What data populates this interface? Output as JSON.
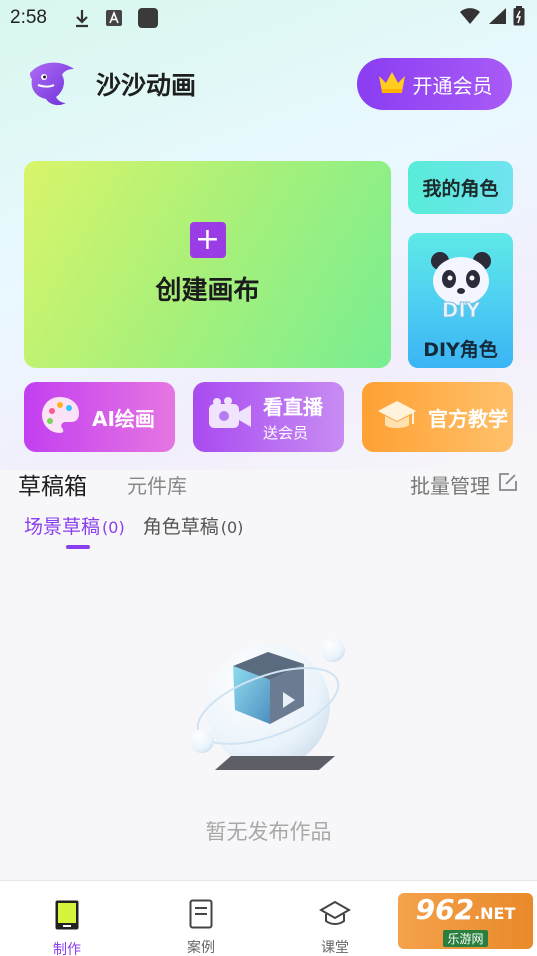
{
  "status_bar": {
    "time": "2:58",
    "icons": [
      "download-icon",
      "text-a-icon",
      "app-square-icon",
      "wifi-icon",
      "signal-icon",
      "battery-icon"
    ]
  },
  "header": {
    "app_title": "沙沙动画",
    "vip_button_label": "开通会员"
  },
  "cards": {
    "create_label": "创建画布",
    "my_role_label": "我的角色",
    "diy_role_label": "DIY角色"
  },
  "quick_actions": {
    "ai_drawing": "AI绘画",
    "live_title": "看直播",
    "live_sub": "送会员",
    "tutorial": "官方教学"
  },
  "tabs": {
    "drafts": "草稿箱",
    "components": "元件库",
    "batch_manage": "批量管理"
  },
  "subtabs": {
    "scene_drafts": "场景草稿",
    "scene_count": "(0)",
    "role_drafts": "角色草稿",
    "role_count": "(0)"
  },
  "empty_state": {
    "message": "暂无发布作品"
  },
  "bottom_nav": {
    "make": "制作",
    "cases": "案例",
    "class": "课堂"
  },
  "watermark": {
    "top": "962",
    "net": ".NET",
    "bottom": "乐游网"
  },
  "colors": {
    "accent_purple": "#8b3df0",
    "create_green": "#a7f07a",
    "teal": "#58ecd8",
    "orange": "#ffa133"
  }
}
